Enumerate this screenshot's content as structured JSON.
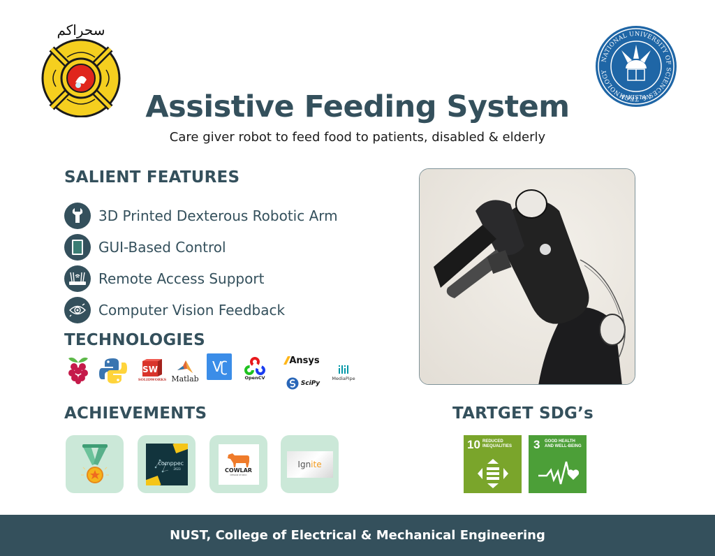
{
  "header": {
    "title": "Assistive Feeding System",
    "subtitle": "Care giver robot to feed food to patients, disabled & elderly",
    "left_logo": {
      "icon": "eme-college-crest-icon",
      "script_text": "سحراكم"
    },
    "right_logo": {
      "icon": "nust-seal-icon",
      "ring_text": "NATIONAL UNIVERSITY OF SCIENCES & TECHNOLOGY",
      "bottom_text": "PAKISTAN"
    }
  },
  "features": {
    "heading": "SALIENT FEATURES",
    "items": [
      {
        "label": "3D Printed Dexterous Robotic Arm",
        "icon": "wrench-icon"
      },
      {
        "label": "GUI-Based Control",
        "icon": "tablet-icon"
      },
      {
        "label": "Remote Access Support",
        "icon": "router-icon"
      },
      {
        "label": "Computer Vision Feedback",
        "icon": "eye-scan-icon"
      }
    ]
  },
  "technologies": {
    "heading": "TECHNOLOGIES",
    "items": [
      {
        "name": "Raspberry Pi",
        "icon": "raspberry-pi-icon",
        "caption": ""
      },
      {
        "name": "Python",
        "icon": "python-icon",
        "caption": ""
      },
      {
        "name": "SolidWorks",
        "icon": "solidworks-icon",
        "caption": "SOLIDWORKS",
        "badge": "SW"
      },
      {
        "name": "Matlab",
        "icon": "matlab-icon",
        "caption": "Matlab"
      },
      {
        "name": "VNC",
        "icon": "vnc-icon",
        "caption": "",
        "badge": "Vʗ"
      },
      {
        "name": "OpenCV",
        "icon": "opencv-icon",
        "caption": "OpenCV"
      },
      {
        "name": "Ansys",
        "icon": "ansys-icon",
        "caption": "Ansys"
      },
      {
        "name": "SciPy",
        "icon": "scipy-icon",
        "caption": "SciPy"
      },
      {
        "name": "MediaPipe",
        "icon": "mediapipe-icon",
        "caption": "MediaPipe"
      }
    ]
  },
  "photo": {
    "alt": "3D printed robotic arm",
    "icon": "robotic-arm-photo"
  },
  "achievements": {
    "heading": "ACHIEVEMENTS",
    "items": [
      {
        "name": "Medal",
        "icon": "medal-icon"
      },
      {
        "name": "Comppec",
        "icon": "comppec-logo",
        "caption": "comppec",
        "year": "2023"
      },
      {
        "name": "Cowlar",
        "icon": "cowlar-logo",
        "caption": "COWLAR",
        "sub": "DESIGN STUDIO"
      },
      {
        "name": "Ignite",
        "icon": "ignite-logo",
        "caption_a": "Ign",
        "caption_b": "ite"
      }
    ]
  },
  "sdgs": {
    "heading": "TARTGET SDG’s",
    "items": [
      {
        "number": "10",
        "line1": "REDUCED",
        "line2": "INEQUALITIES",
        "color": "#7aa52b",
        "icon": "reduced-inequalities-icon"
      },
      {
        "number": "3",
        "line1": "GOOD HEALTH",
        "line2": "AND WELL-BEING",
        "color": "#4c9f38",
        "icon": "heartbeat-icon"
      }
    ]
  },
  "footer": {
    "text": "NUST, College of Electrical & Mechanical Engineering"
  },
  "colors": {
    "primary": "#34505c",
    "tile_bg": "#cbe8d8",
    "footer_bg": "#34505c"
  }
}
